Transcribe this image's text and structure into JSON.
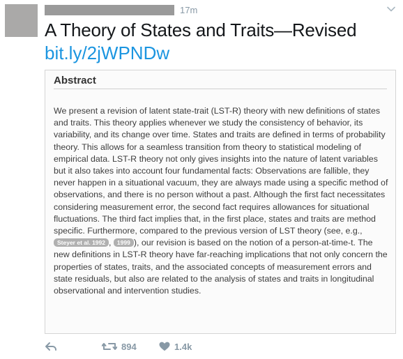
{
  "tweet": {
    "timestamp": "17m",
    "title": "A Theory of States and Traits—Revised",
    "link": "bit.ly/2jWPNDw"
  },
  "abstract": {
    "heading": "Abstract",
    "text_part1": "We present a revision of latent state-trait (LST-R) theory with new definitions of states and traits. This theory applies whenever we study the consistency of behavior, its variability, and its change over time. States and traits are defined in terms of probability theory. This allows for a seamless transition from theory to statistical modeling of empirical data. LST-R theory not only gives insights into the nature of latent variables but it also takes into account four fundamental facts: Observations are fallible, they never happen in a situational vacuum, they are always made using a specific method of observations, and there is no person without a past. Although the first fact necessitates considering measurement error, the second fact requires allowances for situational fluctuations. The third fact implies that, in the first place, states and traits are method specific. Furthermore, compared to the previous version of LST theory (see, e.g., ",
    "ref1": "Steyer et al. 1992",
    "sep": ", ",
    "ref2": "1999",
    "text_part2": "), our revision is based on the notion of a person-at-time-t. The new definitions in LST-R theory have far-reaching implications that not only concern the properties of states, traits, and the associated concepts of measurement errors and state residuals, but also are related to the analysis of states and traits in longitudinal observational and intervention studies."
  },
  "actions": {
    "retweet_count": "894",
    "like_count": "1.4k"
  },
  "icons": {
    "reply": "reply-icon",
    "retweet": "retweet-icon",
    "like": "heart-icon",
    "more": "chevron-down-icon"
  },
  "colors": {
    "link": "#1b95e0",
    "muted": "#8899a6"
  }
}
